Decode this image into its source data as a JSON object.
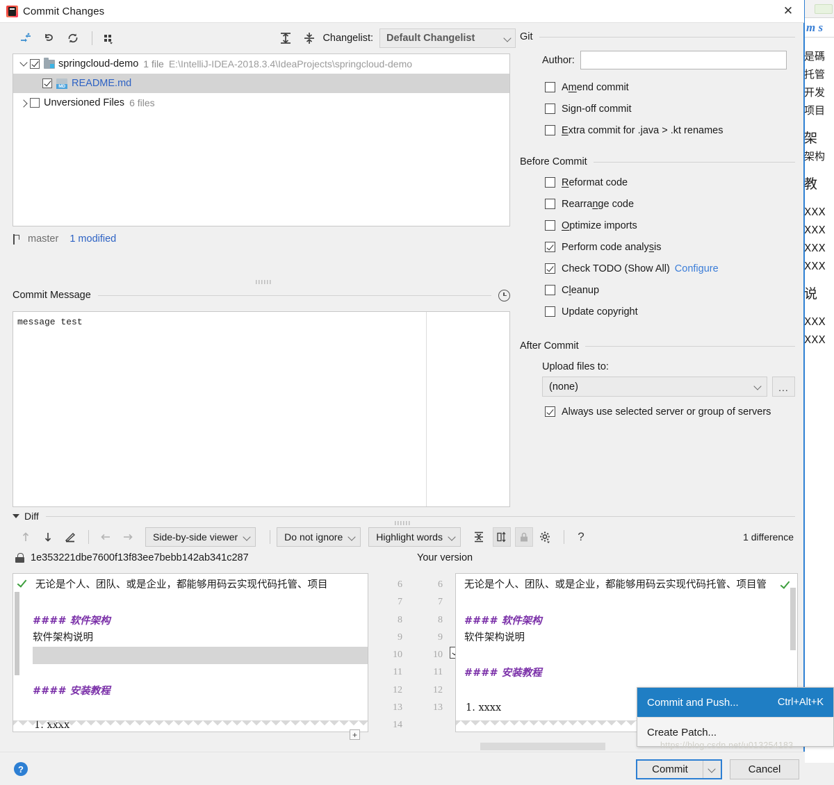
{
  "window": {
    "title": "Commit Changes",
    "logo_icon": "intellij-idea-logo",
    "close_icon": "close-icon"
  },
  "toolbar": {
    "icons": [
      {
        "name": "move-to-another-changelist-icon",
        "glyph": "arrows-converge"
      },
      {
        "name": "rollback-icon",
        "glyph": "undo-arrow"
      },
      {
        "name": "refresh-icon",
        "glyph": "refresh-arrows"
      },
      {
        "name": "group-by-icon",
        "glyph": "grid-dots"
      }
    ],
    "expand_all_icon": "expand-all-icon",
    "collapse_all_icon": "collapse-all-icon",
    "changelist_label": "Changelist:",
    "changelist_value": "Default Changelist"
  },
  "file_tree": {
    "rows": [
      {
        "name": "springcloud-demo",
        "meta": "1 file",
        "path": "E:\\IntelliJ-IDEA-2018.3.4\\IdeaProjects\\springcloud-demo",
        "checked": true,
        "expanded": true,
        "selected": false,
        "icon": "folder-icon",
        "indent": 0
      },
      {
        "name": "README.md",
        "meta": "",
        "path": "",
        "checked": true,
        "expanded": null,
        "selected": true,
        "icon": "markdown-file-icon",
        "indent": 1
      },
      {
        "name": "Unversioned Files",
        "meta": "6 files",
        "path": "",
        "checked": false,
        "expanded": false,
        "selected": false,
        "icon": "none",
        "indent": 0
      }
    ]
  },
  "branch_bar": {
    "branch_icon": "branch-icon",
    "branch": "master",
    "modified": "1 modified"
  },
  "commit_message": {
    "label": "Commit Message",
    "history_icon": "clock-history-icon",
    "value": "message test"
  },
  "git_section": {
    "title": "Git",
    "author_label": "Author:",
    "author_value": "",
    "checkboxes": [
      {
        "label_pre": "A",
        "label_mn": "m",
        "label_post": "end commit",
        "checked": false
      },
      {
        "label_pre": "Si",
        "label_mn": "g",
        "label_post": "n-off commit",
        "checked": false
      },
      {
        "label_pre": "",
        "label_mn": "E",
        "label_post": "xtra commit for .java > .kt renames",
        "checked": false
      }
    ]
  },
  "before_commit": {
    "title": "Before Commit",
    "checkboxes": [
      {
        "label_pre": "",
        "label_mn": "R",
        "label_post": "eformat code",
        "checked": false
      },
      {
        "label_pre": "Rearra",
        "label_mn": "n",
        "label_post": "ge code",
        "checked": false
      },
      {
        "label_pre": "",
        "label_mn": "O",
        "label_post": "ptimize imports",
        "checked": false
      },
      {
        "label_pre": "Perform code analy",
        "label_mn": "s",
        "label_post": "is",
        "checked": true
      },
      {
        "label_pre": "Check TODO (Show All)",
        "label_mn": "",
        "label_post": "",
        "checked": true,
        "link": "Configure"
      },
      {
        "label_pre": "C",
        "label_mn": "l",
        "label_post": "eanup",
        "checked": false
      },
      {
        "label_pre": "Update copyright",
        "label_mn": "",
        "label_post": "",
        "checked": false
      }
    ]
  },
  "after_commit": {
    "title": "After Commit",
    "upload_label": "Upload files to:",
    "upload_value": "(none)",
    "browse_label": "...",
    "always_use_label": "Always use selected server or group of servers",
    "always_use_checked": true
  },
  "diff": {
    "section_label": "Diff",
    "toolbar": {
      "prev_diff_icon": "arrow-up-icon",
      "next_diff_icon": "arrow-down-icon",
      "edit_icon": "pencil-icon",
      "accept_left_icon": "arrow-left-icon",
      "accept_right_icon": "arrow-right-icon",
      "viewer_mode": "Side-by-side viewer",
      "ignore_mode": "Do not ignore",
      "highlight_mode": "Highlight words",
      "collapse_unchanged_icon": "collapse-unchanged-icon",
      "sync_scroll_icon": "sync-scroll-icon",
      "lock_icon": "lock-icon",
      "settings_icon": "gear-icon",
      "help_icon": "question-mark-icon",
      "difference_count": "1 difference"
    },
    "left_header_icon": "lock-icon",
    "left_header": "1e353221dbe7600f13f83ee7bebb142ab341c287",
    "right_header": "Your version",
    "left_gutter_numbers": [
      "6",
      "7",
      "8",
      "9",
      "10",
      "11",
      "12",
      "13",
      "14"
    ],
    "right_gutter_numbers": [
      "6",
      "7",
      "8",
      "9",
      "10",
      "11",
      "12",
      "13"
    ],
    "left_lines": [
      {
        "text": "无论是个人、团队、或是企业，都能够用码云实现代码托管、项目",
        "style": "normal"
      },
      {
        "text": "",
        "style": "normal"
      },
      {
        "text": "#### 软件架构",
        "style": "header"
      },
      {
        "text": "软件架构说明",
        "style": "normal"
      },
      {
        "text": "",
        "style": "gray"
      },
      {
        "text": "",
        "style": "normal"
      },
      {
        "text": "#### 安装教程",
        "style": "header"
      },
      {
        "text": "",
        "style": "normal"
      },
      {
        "text": "1.  xxxx",
        "style": "normal"
      }
    ],
    "right_lines": [
      {
        "text": "无论是个人、团队、或是企业，都能够用码云实现代码托管、项目管",
        "style": "normal"
      },
      {
        "text": "",
        "style": "normal"
      },
      {
        "text": "#### 软件架构",
        "style": "header"
      },
      {
        "text": "软件架构说明",
        "style": "normal"
      },
      {
        "text": "",
        "style": "normal"
      },
      {
        "text": "#### 安装教程",
        "style": "header"
      },
      {
        "text": "",
        "style": "normal"
      },
      {
        "text": "1.  xxxx",
        "style": "normal"
      }
    ]
  },
  "context_menu": {
    "items": [
      {
        "label": "Commit and Push...",
        "shortcut": "Ctrl+Alt+K",
        "highlighted": true
      },
      {
        "label": "Create Patch...",
        "shortcut": "",
        "highlighted": false
      }
    ]
  },
  "bottom": {
    "help_icon": "help-icon",
    "help_label": "?",
    "commit_label": "Commit",
    "commit_dropdown_icon": "chevron-down-icon",
    "cancel_label": "Cancel"
  },
  "watermark": "https://blog.csdn.net/u013254183",
  "background": {
    "tab_text": "m s",
    "lines": [
      "是碼",
      "托管",
      "开发",
      "项目",
      "",
      "架",
      "架构",
      "教",
      "XXX",
      "XXX",
      "XXX",
      "XXX",
      "说",
      "XXX",
      "XXX"
    ]
  },
  "colors": {
    "accent": "#2d7fd3",
    "link": "#2d62c4",
    "menu_highlight": "#1f7ec4",
    "md_header": "#7a2fa8",
    "selection": "#d4d4d4"
  }
}
